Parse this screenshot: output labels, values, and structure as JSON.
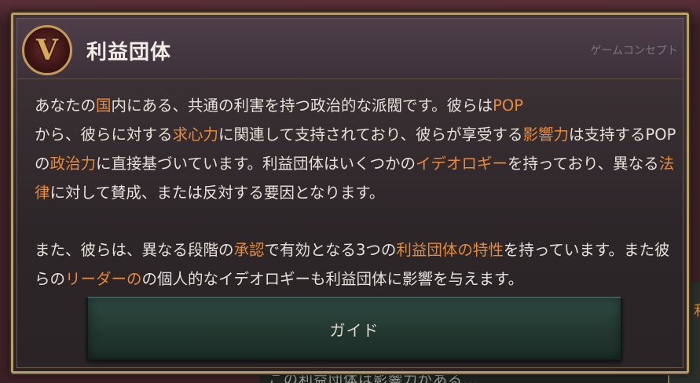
{
  "tooltip": {
    "title": "利益団体",
    "category": "ゲームコンセプト",
    "emblem_letter": "V",
    "paragraph1": [
      {
        "t": "あなたの"
      },
      {
        "t": "国",
        "hl": true
      },
      {
        "t": "内にある、共通の利害を持つ政治的な派閥です。彼らは"
      },
      {
        "t": "POP",
        "hl": true
      },
      {
        "t": "\nから、彼らに対する"
      },
      {
        "t": "求心力",
        "hl": true
      },
      {
        "t": "に関連して支持されており、彼らが享受する"
      },
      {
        "t": "影響力",
        "hl": true
      },
      {
        "t": "は支持するPOPの"
      },
      {
        "t": "政治力",
        "hl": true
      },
      {
        "t": "に直接基づいています。利益団体はいくつかの"
      },
      {
        "t": "イデオロギー",
        "hl": true
      },
      {
        "t": "を持っており、異なる"
      },
      {
        "t": "法律",
        "hl": true
      },
      {
        "t": "に対して賛成、または反対する要因となります。"
      }
    ],
    "paragraph2": [
      {
        "t": "また、彼らは、異なる段階の"
      },
      {
        "t": "承認",
        "hl": true
      },
      {
        "t": "で有効となる3つの"
      },
      {
        "t": "利益団体の特性",
        "hl": true
      },
      {
        "t": "を持っています。また彼らの"
      },
      {
        "t": "リーダーの",
        "hl": true
      },
      {
        "t": "の個人的なイデオロギーも利益団体に影響を与えます。"
      }
    ],
    "guide_label": "ガイド"
  },
  "background": {
    "right_char": "利",
    "under_text": "この利益団体は影響力がある..."
  },
  "colors": {
    "highlight": "#e88a3a",
    "text": "#e6e1da",
    "frame": "#b99d6a",
    "button": "#2f4a44"
  },
  "icons": {
    "emblem": "victoria-emblem-icon"
  }
}
